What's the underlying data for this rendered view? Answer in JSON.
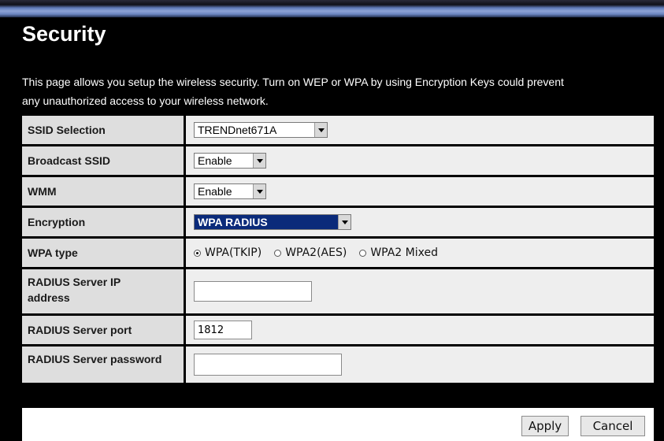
{
  "page": {
    "title": "Security",
    "description_line1": "This page allows you setup the wireless security. Turn on WEP or WPA by using Encryption Keys could prevent",
    "description_line2": "any unauthorized access to your wireless network."
  },
  "form": {
    "ssid_selection": {
      "label": "SSID Selection",
      "value": "TRENDnet671A"
    },
    "broadcast_ssid": {
      "label": "Broadcast SSID",
      "value": "Enable"
    },
    "wmm": {
      "label": "WMM",
      "value": "Enable"
    },
    "encryption": {
      "label": "Encryption",
      "value": "WPA RADIUS"
    },
    "wpa_type": {
      "label": "WPA type",
      "options": [
        "WPA(TKIP)",
        "WPA2(AES)",
        "WPA2 Mixed"
      ],
      "selected": "WPA(TKIP)"
    },
    "radius_ip": {
      "label_line1": "RADIUS Server IP",
      "label_line2": "address",
      "value": ""
    },
    "radius_port": {
      "label": "RADIUS Server port",
      "value": "1812"
    },
    "radius_password": {
      "label": "RADIUS Server password",
      "value": ""
    }
  },
  "buttons": {
    "apply": "Apply",
    "cancel": "Cancel"
  }
}
